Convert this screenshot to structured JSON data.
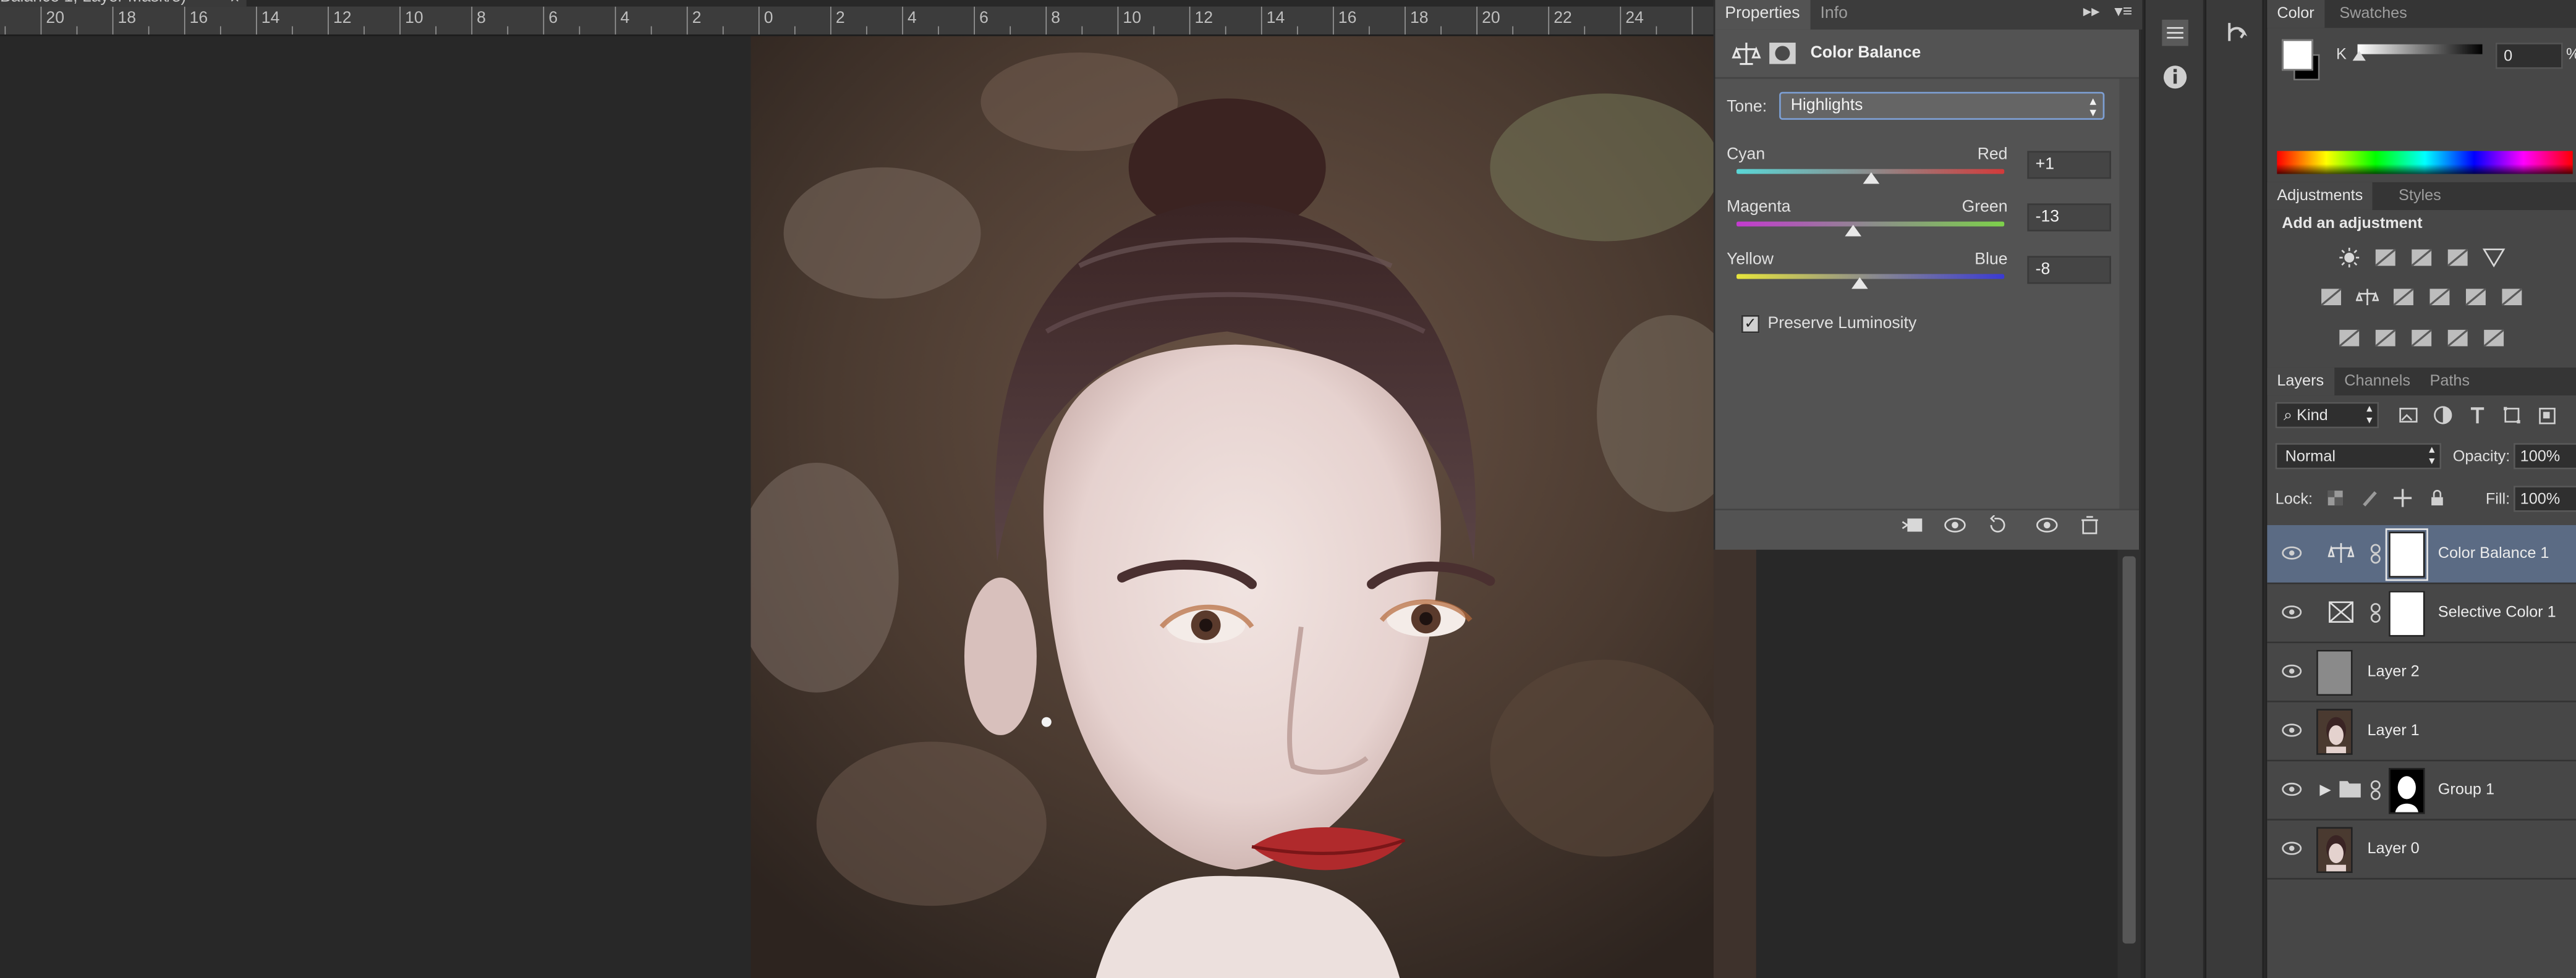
{
  "document": {
    "tab_title": "Balance 1, Layer Mask/8)",
    "tab_close": "×",
    "ruler_ticks": [
      "20",
      "18",
      "16",
      "14",
      "12",
      "10",
      "8",
      "6",
      "4",
      "2",
      "0",
      "2",
      "4",
      "6",
      "8",
      "10",
      "12",
      "14",
      "16",
      "18",
      "20",
      "22",
      "24"
    ]
  },
  "properties": {
    "tabs": [
      {
        "label": "Properties",
        "active": true
      },
      {
        "label": "Info",
        "active": false
      }
    ],
    "menu_glyphs": {
      "collapse": "▸▸",
      "menu": "▾≡"
    },
    "title": "Color Balance",
    "tone_label": "Tone:",
    "tone_value": "Highlights",
    "sliders": [
      {
        "left": "Cyan",
        "right": "Red",
        "value": "+1",
        "fraction": 0.503,
        "gradient": "linear-gradient(to right, #5ad7d7, #8c8c8c, #d33a3a)"
      },
      {
        "left": "Magenta",
        "right": "Green",
        "value": "-13",
        "fraction": 0.435,
        "gradient": "linear-gradient(to right, #c43ad0, #8c8c8c, #7dd14a)"
      },
      {
        "left": "Yellow",
        "right": "Blue",
        "value": "-8",
        "fraction": 0.46,
        "gradient": "linear-gradient(to right, #e7e53c, #8c8c8c, #3a3ad3)"
      }
    ],
    "preserve_label": "Preserve Luminosity",
    "preserve_checked": "✓",
    "footer_icons": [
      "clip-to-layer-icon",
      "view-previous-icon",
      "reset-icon",
      "visibility-icon",
      "delete-icon"
    ]
  },
  "color_panel": {
    "tabs": [
      {
        "label": "Color",
        "active": true
      },
      {
        "label": "Swatches",
        "active": false
      }
    ],
    "channel_label": "K",
    "channel_value": "0",
    "unit": "%",
    "fg_color": "#ffffff",
    "bg_color": "#000000"
  },
  "adjustments_panel": {
    "tabs": [
      {
        "label": "Adjustments",
        "active": true
      },
      {
        "label": "Styles",
        "active": false
      }
    ],
    "title": "Add an adjustment",
    "icon_rows": [
      [
        "brightness-contrast-icon",
        "levels-icon",
        "curves-icon",
        "exposure-icon",
        "triangle-icon"
      ],
      [
        "vibrance-icon",
        "color-balance-icon",
        "black-white-icon",
        "photo-filter-icon",
        "channel-mixer-icon",
        "color-lookup-icon"
      ],
      [
        "invert-icon",
        "posterize-icon",
        "threshold-icon",
        "selective-color-icon",
        "gradient-map-icon"
      ]
    ]
  },
  "layers_panel": {
    "tabs": [
      {
        "label": "Layers",
        "active": true
      },
      {
        "label": "Channels",
        "active": false
      },
      {
        "label": "Paths",
        "active": false
      }
    ],
    "kind_label": "Kind",
    "blend_mode": "Normal",
    "opacity_label": "Opacity:",
    "opacity_value": "100%",
    "lock_label": "Lock:",
    "fill_label": "Fill:",
    "fill_value": "100%",
    "layers": [
      {
        "name": "Color Balance 1",
        "kind": "adjustment-balance",
        "selected": true
      },
      {
        "name": "Selective Color 1",
        "kind": "adjustment-selective",
        "selected": false
      },
      {
        "name": "Layer 2",
        "kind": "gray",
        "selected": false
      },
      {
        "name": "Layer 1",
        "kind": "photo",
        "selected": false
      },
      {
        "name": "Group 1",
        "kind": "group",
        "selected": false
      },
      {
        "name": "Layer 0",
        "kind": "photo",
        "selected": false
      }
    ]
  }
}
